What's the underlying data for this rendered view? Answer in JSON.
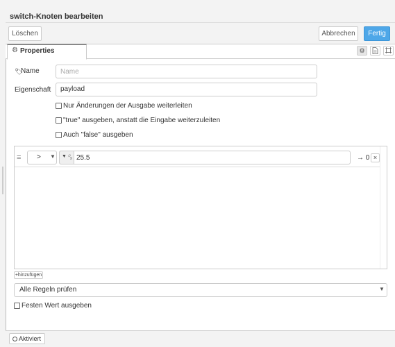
{
  "dialog": {
    "title": "switch-Knoten bearbeiten"
  },
  "toolbar": {
    "delete_label": "Löschen",
    "cancel_label": "Abbrechen",
    "done_label": "Fertig"
  },
  "tabs": {
    "active_label": "Properties",
    "active_icon": "gear-icon",
    "side_icons": [
      "gear-icon",
      "document-icon",
      "frame-icon"
    ]
  },
  "form": {
    "name_label": "Name",
    "name_placeholder": "Name",
    "name_value": "",
    "property_label": "Eigenschaft",
    "property_value": "payload",
    "checkboxes": [
      {
        "label": "Nur Änderungen der Ausgabe weiterleiten",
        "checked": false
      },
      {
        "label": "\"true\" ausgeben, anstatt die Eingabe weiterzuleiten",
        "checked": false
      },
      {
        "label": "Auch \"false\" ausgeben",
        "checked": false
      }
    ]
  },
  "rules": [
    {
      "operator": ">",
      "value_type_icon": "number-type-icon",
      "value": "25.5",
      "output": "→ 0",
      "delete_label": "×"
    }
  ],
  "add_button_label": "+hinzufügen",
  "mode_select": {
    "value": "Alle Regeln prüfen"
  },
  "fixed_value": {
    "label": "Festen Wert ausgeben",
    "checked": false
  },
  "footer": {
    "status_label": "Aktiviert"
  },
  "colors": {
    "accent": "#4ea7e8",
    "border": "#cccccc",
    "background": "#f3f3f3"
  }
}
